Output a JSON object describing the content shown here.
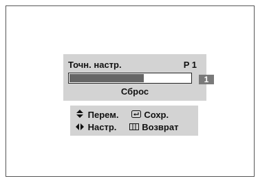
{
  "menu": {
    "title": "Точн. настр.",
    "program": "P 1",
    "slider_value": "1",
    "slider_level_percent": 62,
    "reset_label": "Сброс"
  },
  "help": {
    "move_icon": "up-down-arrows",
    "move_label": "Перем.",
    "save_icon": "enter-key",
    "save_label": "Сохр.",
    "adjust_icon": "left-right-arrows",
    "adjust_label": "Настр.",
    "return_icon": "menu-return",
    "return_label": "Возврат"
  },
  "colors": {
    "panel": "#d3d3d3",
    "fill": "#666666",
    "value_box": "#7a7a7a"
  }
}
